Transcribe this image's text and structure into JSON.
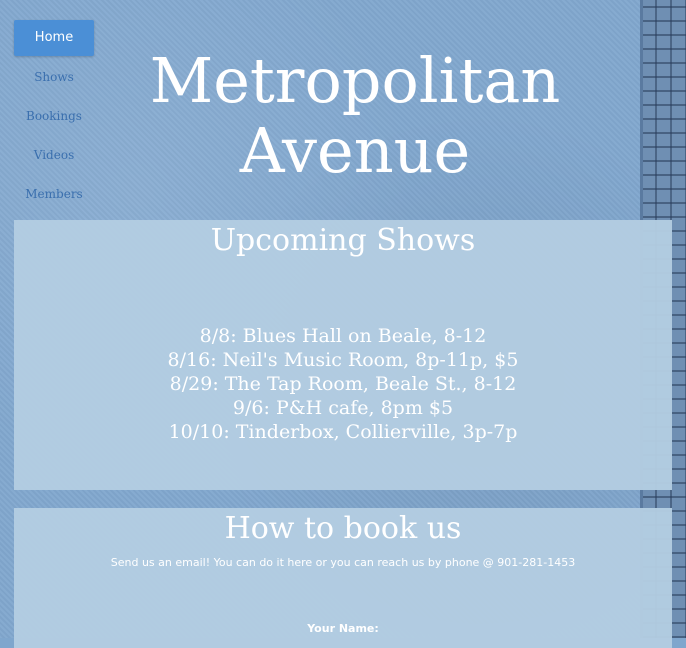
{
  "nav": {
    "items": [
      "Home",
      "Shows",
      "Bookings",
      "Videos",
      "Members"
    ]
  },
  "site": {
    "title_line1": "Metropolitan",
    "title_line2": "Avenue"
  },
  "shows": {
    "title": "Upcoming Shows",
    "list": [
      "8/8: Blues Hall on Beale, 8-12",
      "8/16: Neil's Music Room, 8p-11p, $5",
      "8/29: The Tap Room, Beale St., 8-12",
      "9/6: P&H cafe, 8pm $5",
      "10/10: Tinderbox, Collierville, 3p-7p"
    ]
  },
  "booking": {
    "title": "How to book us",
    "text": "Send us an email! You can do it here or you can reach us by phone @ 901-281-1453",
    "name_label": "Your Name:"
  }
}
